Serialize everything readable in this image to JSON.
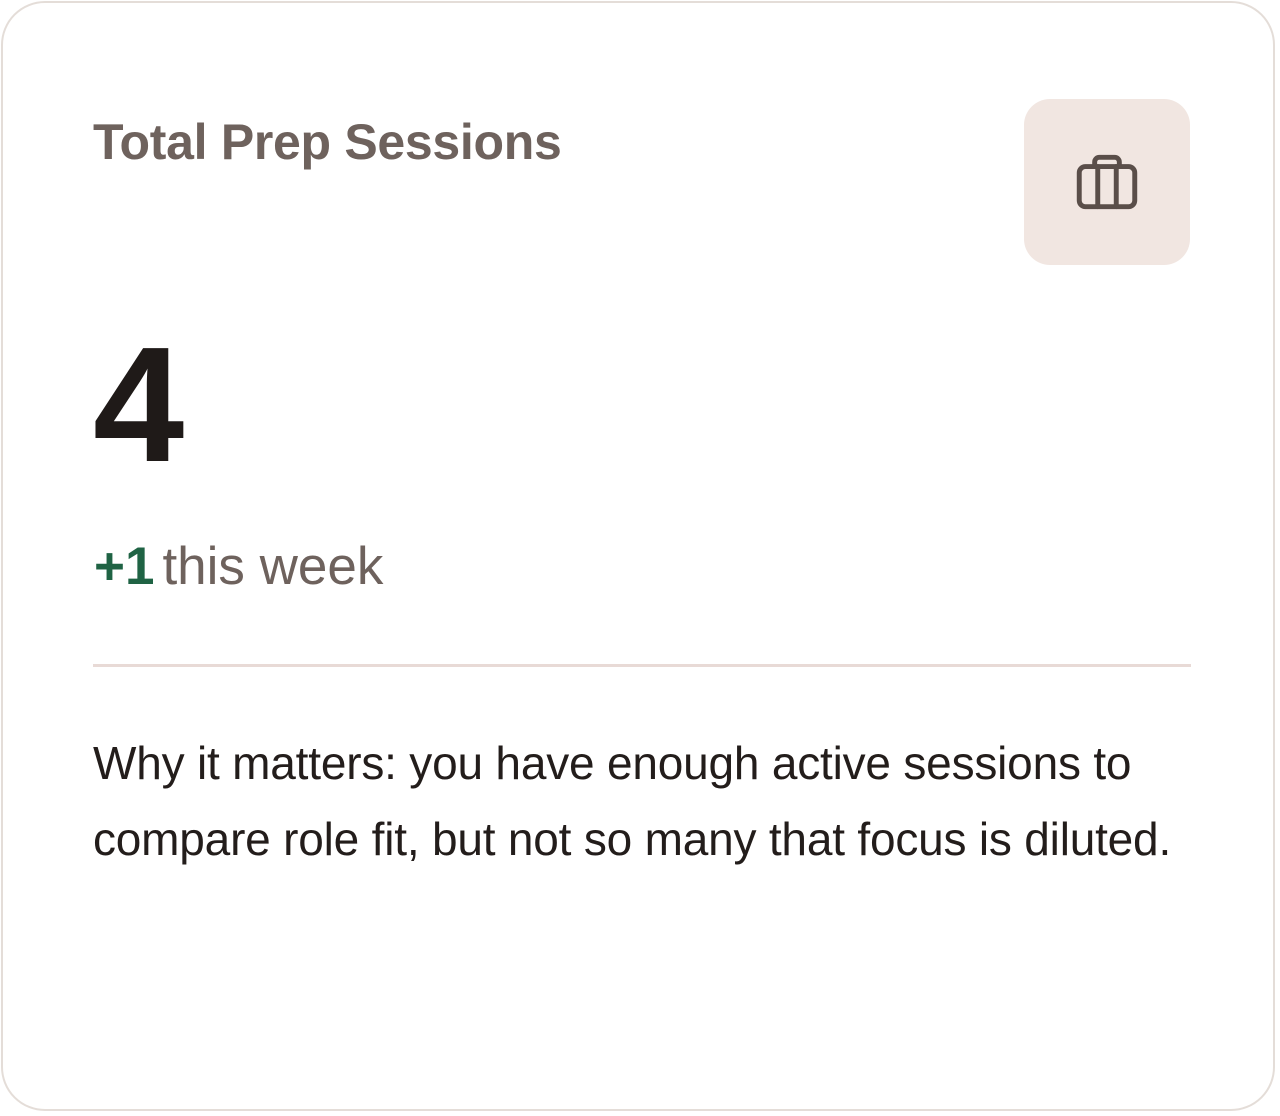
{
  "card": {
    "title": "Total Prep Sessions",
    "icon": "briefcase-icon",
    "value": "4",
    "delta": {
      "value": "+1",
      "label": "this week"
    },
    "explanation": "Why it matters: you have enough active sessions to compare role fit, but not so many that focus is diluted."
  },
  "colors": {
    "title": "#6e625d",
    "value": "#1f1a18",
    "delta_positive": "#1f6344",
    "icon_tile_bg": "#f1e6e1",
    "icon_stroke": "#5a4e49",
    "divider": "#e8dad6",
    "border": "#e4ddd8"
  }
}
